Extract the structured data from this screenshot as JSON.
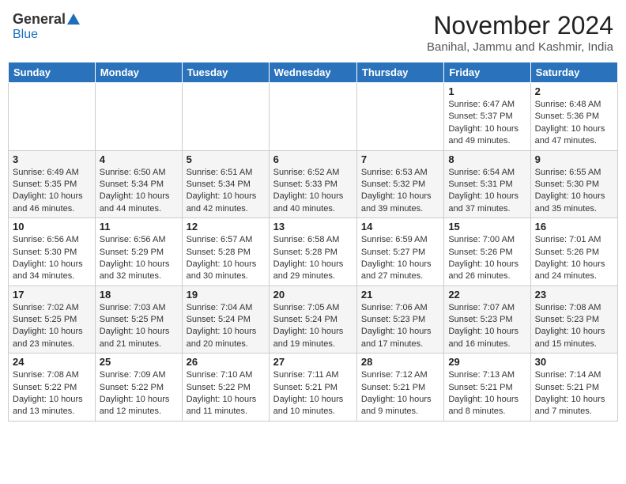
{
  "logo": {
    "general": "General",
    "blue": "Blue"
  },
  "title": "November 2024",
  "location": "Banihal, Jammu and Kashmir, India",
  "weekdays": [
    "Sunday",
    "Monday",
    "Tuesday",
    "Wednesday",
    "Thursday",
    "Friday",
    "Saturday"
  ],
  "weeks": [
    [
      {
        "day": "",
        "info": ""
      },
      {
        "day": "",
        "info": ""
      },
      {
        "day": "",
        "info": ""
      },
      {
        "day": "",
        "info": ""
      },
      {
        "day": "",
        "info": ""
      },
      {
        "day": "1",
        "info": "Sunrise: 6:47 AM\nSunset: 5:37 PM\nDaylight: 10 hours and 49 minutes."
      },
      {
        "day": "2",
        "info": "Sunrise: 6:48 AM\nSunset: 5:36 PM\nDaylight: 10 hours and 47 minutes."
      }
    ],
    [
      {
        "day": "3",
        "info": "Sunrise: 6:49 AM\nSunset: 5:35 PM\nDaylight: 10 hours and 46 minutes."
      },
      {
        "day": "4",
        "info": "Sunrise: 6:50 AM\nSunset: 5:34 PM\nDaylight: 10 hours and 44 minutes."
      },
      {
        "day": "5",
        "info": "Sunrise: 6:51 AM\nSunset: 5:34 PM\nDaylight: 10 hours and 42 minutes."
      },
      {
        "day": "6",
        "info": "Sunrise: 6:52 AM\nSunset: 5:33 PM\nDaylight: 10 hours and 40 minutes."
      },
      {
        "day": "7",
        "info": "Sunrise: 6:53 AM\nSunset: 5:32 PM\nDaylight: 10 hours and 39 minutes."
      },
      {
        "day": "8",
        "info": "Sunrise: 6:54 AM\nSunset: 5:31 PM\nDaylight: 10 hours and 37 minutes."
      },
      {
        "day": "9",
        "info": "Sunrise: 6:55 AM\nSunset: 5:30 PM\nDaylight: 10 hours and 35 minutes."
      }
    ],
    [
      {
        "day": "10",
        "info": "Sunrise: 6:56 AM\nSunset: 5:30 PM\nDaylight: 10 hours and 34 minutes."
      },
      {
        "day": "11",
        "info": "Sunrise: 6:56 AM\nSunset: 5:29 PM\nDaylight: 10 hours and 32 minutes."
      },
      {
        "day": "12",
        "info": "Sunrise: 6:57 AM\nSunset: 5:28 PM\nDaylight: 10 hours and 30 minutes."
      },
      {
        "day": "13",
        "info": "Sunrise: 6:58 AM\nSunset: 5:28 PM\nDaylight: 10 hours and 29 minutes."
      },
      {
        "day": "14",
        "info": "Sunrise: 6:59 AM\nSunset: 5:27 PM\nDaylight: 10 hours and 27 minutes."
      },
      {
        "day": "15",
        "info": "Sunrise: 7:00 AM\nSunset: 5:26 PM\nDaylight: 10 hours and 26 minutes."
      },
      {
        "day": "16",
        "info": "Sunrise: 7:01 AM\nSunset: 5:26 PM\nDaylight: 10 hours and 24 minutes."
      }
    ],
    [
      {
        "day": "17",
        "info": "Sunrise: 7:02 AM\nSunset: 5:25 PM\nDaylight: 10 hours and 23 minutes."
      },
      {
        "day": "18",
        "info": "Sunrise: 7:03 AM\nSunset: 5:25 PM\nDaylight: 10 hours and 21 minutes."
      },
      {
        "day": "19",
        "info": "Sunrise: 7:04 AM\nSunset: 5:24 PM\nDaylight: 10 hours and 20 minutes."
      },
      {
        "day": "20",
        "info": "Sunrise: 7:05 AM\nSunset: 5:24 PM\nDaylight: 10 hours and 19 minutes."
      },
      {
        "day": "21",
        "info": "Sunrise: 7:06 AM\nSunset: 5:23 PM\nDaylight: 10 hours and 17 minutes."
      },
      {
        "day": "22",
        "info": "Sunrise: 7:07 AM\nSunset: 5:23 PM\nDaylight: 10 hours and 16 minutes."
      },
      {
        "day": "23",
        "info": "Sunrise: 7:08 AM\nSunset: 5:23 PM\nDaylight: 10 hours and 15 minutes."
      }
    ],
    [
      {
        "day": "24",
        "info": "Sunrise: 7:08 AM\nSunset: 5:22 PM\nDaylight: 10 hours and 13 minutes."
      },
      {
        "day": "25",
        "info": "Sunrise: 7:09 AM\nSunset: 5:22 PM\nDaylight: 10 hours and 12 minutes."
      },
      {
        "day": "26",
        "info": "Sunrise: 7:10 AM\nSunset: 5:22 PM\nDaylight: 10 hours and 11 minutes."
      },
      {
        "day": "27",
        "info": "Sunrise: 7:11 AM\nSunset: 5:21 PM\nDaylight: 10 hours and 10 minutes."
      },
      {
        "day": "28",
        "info": "Sunrise: 7:12 AM\nSunset: 5:21 PM\nDaylight: 10 hours and 9 minutes."
      },
      {
        "day": "29",
        "info": "Sunrise: 7:13 AM\nSunset: 5:21 PM\nDaylight: 10 hours and 8 minutes."
      },
      {
        "day": "30",
        "info": "Sunrise: 7:14 AM\nSunset: 5:21 PM\nDaylight: 10 hours and 7 minutes."
      }
    ]
  ]
}
